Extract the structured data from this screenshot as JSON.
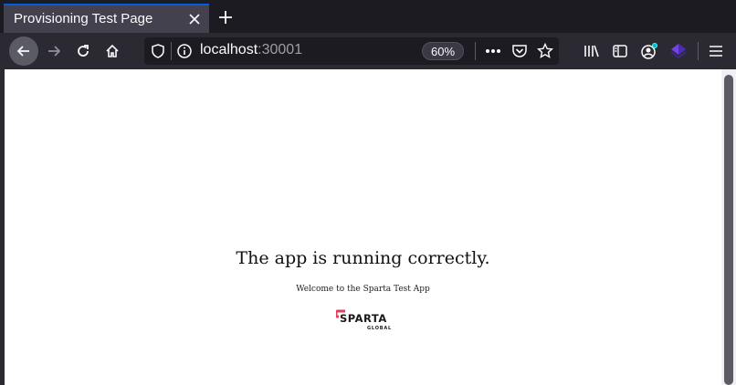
{
  "tab": {
    "title": "Provisioning Test Page"
  },
  "address_bar": {
    "host": "localhost",
    "port": ":30001",
    "zoom": "60%"
  },
  "page": {
    "headline": "The app is running correctly.",
    "subtitle": "Welcome to the Sparta Test App",
    "logo": {
      "brand": "SPARTA",
      "tagline": "GLOBAL",
      "accent": "#e0415a"
    }
  },
  "icons": {
    "tab_close": "close-icon",
    "new_tab": "plus-icon",
    "back": "arrow-left-icon",
    "forward": "arrow-right-icon",
    "reload": "reload-icon",
    "home": "home-icon",
    "shield": "shield-icon",
    "info": "info-icon",
    "more": "more-horizontal-icon",
    "pocket": "pocket-icon",
    "bookmark": "star-icon",
    "library": "library-icon",
    "sidebar": "sidebar-icon",
    "account": "account-icon",
    "extension": "extension-icon",
    "menu": "hamburger-menu-icon"
  },
  "colors": {
    "tab_accent": "#0060df",
    "toolbar": "#2b2a33",
    "tabstrip": "#1c1b22"
  }
}
